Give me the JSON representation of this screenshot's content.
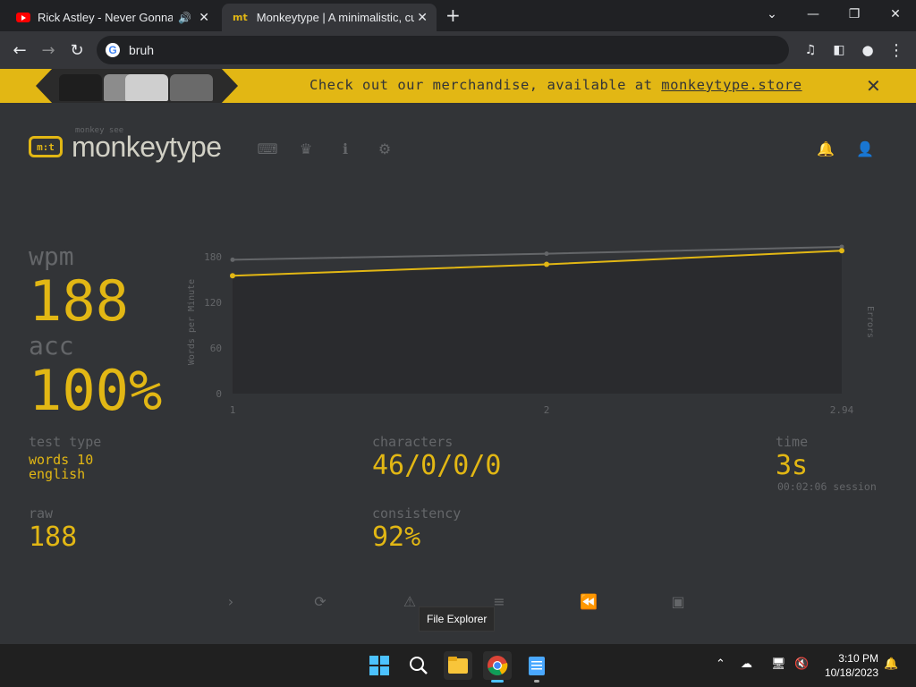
{
  "browser": {
    "tabs": [
      {
        "title": "Rick Astley - Never Gonna Gi",
        "icon": "youtube-icon",
        "audio": true
      },
      {
        "title": "Monkeytype | A minimalistic, cust",
        "icon": "monkeytype-icon",
        "active": true
      }
    ],
    "omnibox": {
      "query": "bruh"
    }
  },
  "banner": {
    "text": "Check out our merchandise, available at ",
    "link": "monkeytype.store"
  },
  "header": {
    "logo_text": "monkeytype",
    "logo_sub": "monkey see",
    "logo_mark": "m:t"
  },
  "stats": {
    "wpm_label": "wpm",
    "wpm": "188",
    "acc_label": "acc",
    "acc": "100%",
    "test_type_label": "test type",
    "test_type_line1": "words 10",
    "test_type_line2": "english",
    "raw_label": "raw",
    "raw": "188",
    "characters_label": "characters",
    "characters": "46/0/0/0",
    "consistency_label": "consistency",
    "consistency": "92%",
    "time_label": "time",
    "time": "3s",
    "session": "00:02:06 session"
  },
  "chart_data": {
    "type": "line",
    "x": [
      1,
      2,
      2.94
    ],
    "x_tick_labels": [
      "1",
      "2",
      "2.94"
    ],
    "series": [
      {
        "values": [
          155,
          170,
          188
        ],
        "color": "#e2b714"
      },
      {
        "values": [
          176,
          184,
          193
        ],
        "color": "#646669"
      }
    ],
    "ylabel": "Words per Minute",
    "y2label": "Errors",
    "yticks": [
      0,
      60,
      120,
      180
    ],
    "ylim": [
      0,
      200
    ],
    "grid": false
  },
  "tooltip": "File Explorer",
  "taskbar": {
    "time": "3:10 PM",
    "date": "10/18/2023"
  },
  "colors": {
    "bg": "#323437",
    "accent": "#e2b714",
    "sub": "#646669",
    "text": "#d1d0c5"
  }
}
